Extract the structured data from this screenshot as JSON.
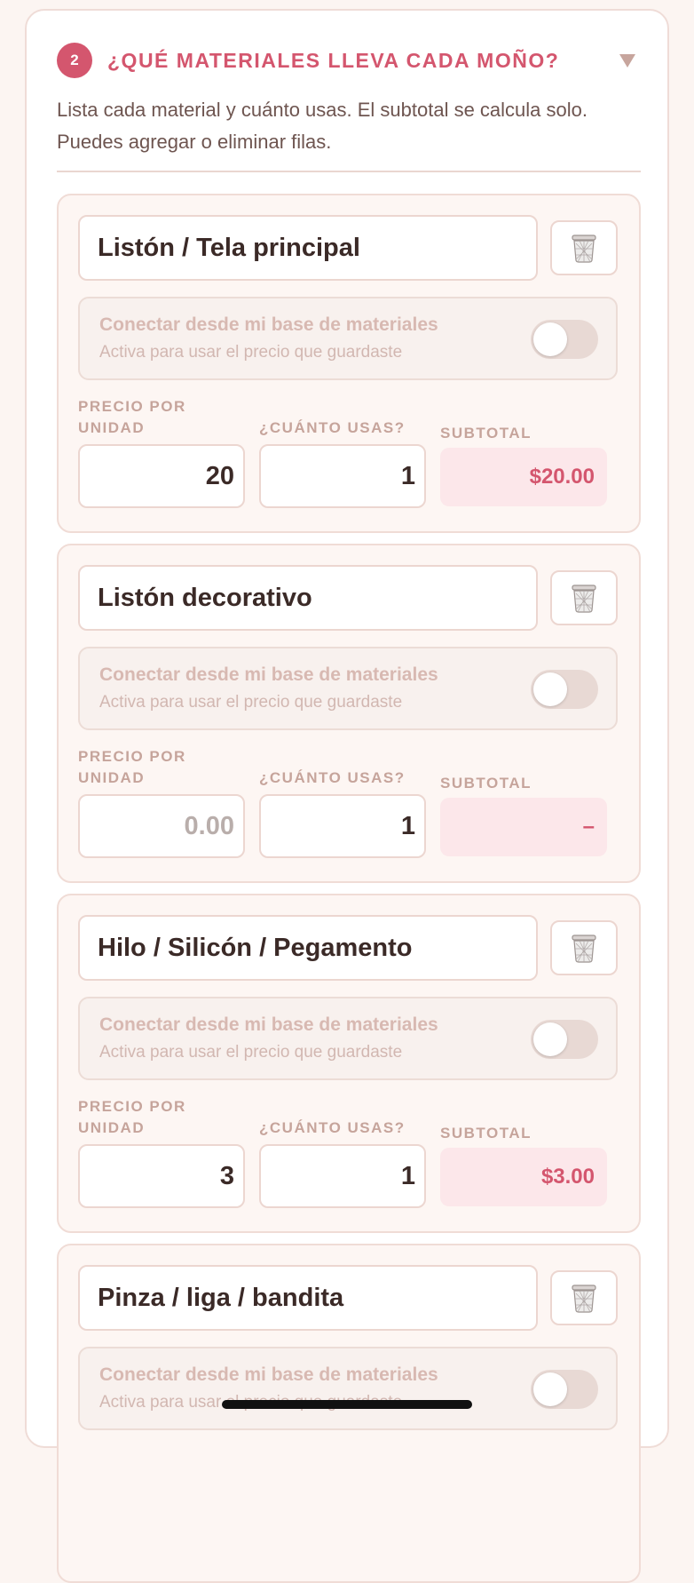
{
  "section": {
    "step": "2",
    "title": "¿QUÉ MATERIALES LLEVA CADA MOÑO?",
    "description": "Lista cada material y cuánto usas. El subtotal se calcula solo. Puedes agregar o eliminar filas."
  },
  "labels": {
    "connect_title": "Conectar desde mi base de materiales",
    "connect_sub": "Activa para usar el precio que guardaste",
    "price_label_line1": "PRECIO POR",
    "price_label_line2": "UNIDAD",
    "qty_label": "¿CUÁNTO USAS?",
    "subtotal_label": "SUBTOTAL",
    "price_placeholder": "0.00"
  },
  "icons": {
    "trash": "trash-icon",
    "caret": "caret-down-icon"
  },
  "colors": {
    "accent": "#d4566e",
    "subtotal_bg": "#fce7ea"
  },
  "materials": [
    {
      "name": "Listón / Tela principal",
      "price": "20",
      "qty": "1",
      "subtotal": "$20.00",
      "connected": false
    },
    {
      "name": "Listón decorativo",
      "price": "",
      "qty": "1",
      "subtotal": "–",
      "connected": false
    },
    {
      "name": "Hilo / Silicón / Pegamento",
      "price": "3",
      "qty": "1",
      "subtotal": "$3.00",
      "connected": false
    },
    {
      "name": "Pinza / liga / bandita",
      "price": "",
      "qty": "",
      "subtotal": "",
      "connected": false
    }
  ]
}
